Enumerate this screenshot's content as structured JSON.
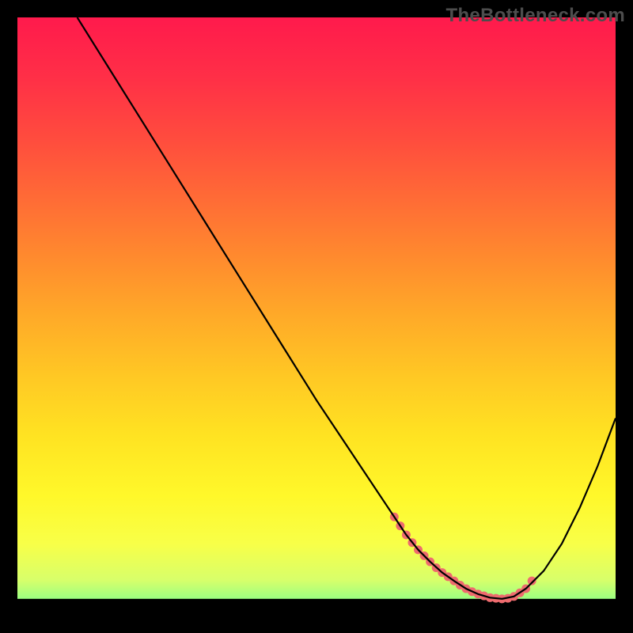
{
  "watermark": "TheBottleneck.com",
  "gradient": {
    "stops": [
      {
        "offset": 0.0,
        "color": "#ff1a4c"
      },
      {
        "offset": 0.1,
        "color": "#ff2f47"
      },
      {
        "offset": 0.2,
        "color": "#ff4b3e"
      },
      {
        "offset": 0.3,
        "color": "#ff6a36"
      },
      {
        "offset": 0.4,
        "color": "#ff8a2e"
      },
      {
        "offset": 0.5,
        "color": "#ffaa28"
      },
      {
        "offset": 0.6,
        "color": "#ffc824"
      },
      {
        "offset": 0.7,
        "color": "#ffe322"
      },
      {
        "offset": 0.8,
        "color": "#fff82a"
      },
      {
        "offset": 0.88,
        "color": "#f8ff48"
      },
      {
        "offset": 0.94,
        "color": "#d8ff6a"
      },
      {
        "offset": 0.97,
        "color": "#a0ff80"
      },
      {
        "offset": 0.99,
        "color": "#5aff8a"
      },
      {
        "offset": 1.0,
        "color": "#1bff7a"
      }
    ]
  },
  "chart_data": {
    "type": "line",
    "title": "",
    "xlabel": "",
    "ylabel": "",
    "xlim": [
      0,
      100
    ],
    "ylim": [
      0,
      100
    ],
    "legend": false,
    "grid": false,
    "series": [
      {
        "name": "curve",
        "color": "#000000",
        "x": [
          10,
          15,
          20,
          25,
          30,
          35,
          40,
          45,
          50,
          55,
          60,
          63,
          65,
          67,
          69,
          71,
          73,
          75,
          77,
          79,
          81,
          83,
          85,
          88,
          91,
          94,
          97,
          100
        ],
        "y": [
          100,
          92,
          84,
          76,
          68,
          60,
          52,
          44,
          36,
          28.5,
          21,
          16.5,
          13.5,
          11,
          9,
          7.2,
          5.8,
          4.5,
          3.6,
          3.0,
          2.8,
          3.2,
          4.5,
          7.5,
          12,
          18,
          25,
          33
        ]
      }
    ],
    "highlight_points": {
      "color": "#ee6b6e",
      "x": [
        63,
        64,
        65,
        66,
        67,
        68,
        69,
        70,
        71,
        72,
        73,
        74,
        75,
        76,
        77,
        78,
        79,
        80,
        81,
        82,
        83,
        84,
        85,
        86
      ],
      "y": [
        16.5,
        15,
        13.5,
        12.2,
        11,
        10,
        9,
        8,
        7.2,
        6.5,
        5.8,
        5.1,
        4.5,
        4.0,
        3.6,
        3.3,
        3.0,
        2.9,
        2.8,
        2.9,
        3.2,
        3.8,
        4.5,
        5.8
      ]
    },
    "baseline_top_y": 2.8
  }
}
